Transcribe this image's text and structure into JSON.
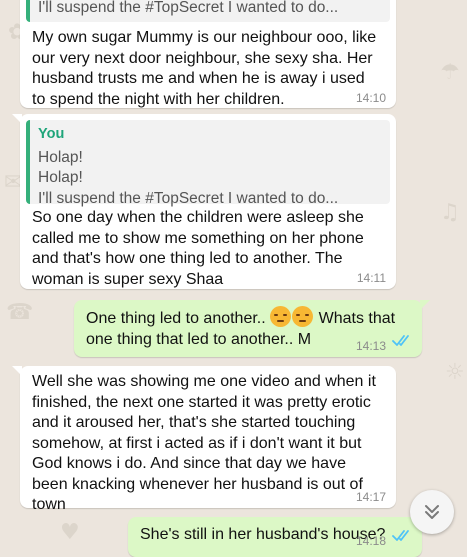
{
  "messages": [
    {
      "direction": "incoming",
      "quote": {
        "line": "I'll suspend the #TopSecret I wanted to do..."
      },
      "text": "My own sugar Mummy is our neighbour ooo, like our very next door neighbour, she sexy sha. Her husband trusts me and when he is away i used to spend the night with her children.",
      "time": "14:10"
    },
    {
      "direction": "incoming",
      "quote": {
        "author": "You",
        "lines": [
          "Holap!",
          "Holap!",
          "I'll suspend the #TopSecret I wanted to do..."
        ]
      },
      "text": "So one day when the children were asleep she called me to show me something on her phone and that's how one thing led to another. The woman is super sexy Shaa",
      "time": "14:11"
    },
    {
      "direction": "outgoing",
      "text_before_emoji": "One thing led to another..",
      "emoji": [
        "unamused-face",
        "unamused-face"
      ],
      "text_after_emoji": "Whats that one thing that led to another.. M",
      "time": "14:13",
      "status": "read"
    },
    {
      "direction": "incoming",
      "text": "Well she was showing me one video and when it finished, the next one started it was pretty erotic and it aroused her, that's she started touching somehow, at first i acted as if i don't want it but God knows i do. And since that day we have been knacking whenever her husband is out of town",
      "time": "14:17"
    },
    {
      "direction": "outgoing",
      "text": "She's still in her husband's house?",
      "time": "14:18",
      "status": "read"
    }
  ],
  "colors": {
    "background": "#ece5dd",
    "incoming_bubble": "#ffffff",
    "outgoing_bubble": "#dcf8c6",
    "quote_accent": "#35b07b",
    "read_ticks": "#4fc3f7",
    "timestamp": "#8b8b8b"
  },
  "icons": {
    "scroll_down": "chevron-double-down-icon",
    "read_receipt": "double-check-icon"
  }
}
